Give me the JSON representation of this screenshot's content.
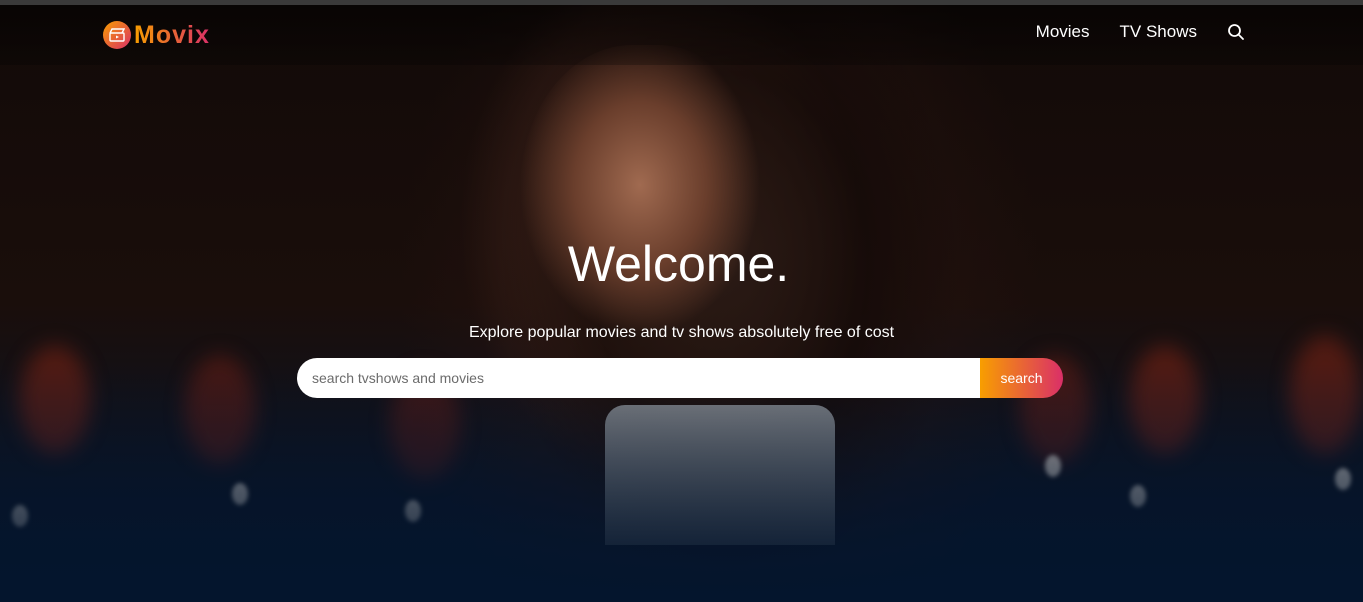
{
  "brand": {
    "name": "Movix",
    "accent_start": "#f89e00",
    "accent_end": "#da2f68",
    "icon": "clapperboard-icon"
  },
  "nav": {
    "items": [
      {
        "label": "Movies"
      },
      {
        "label": "TV Shows"
      }
    ],
    "search_icon": "search-icon"
  },
  "hero": {
    "title": "Welcome.",
    "subtitle": "Explore popular movies and tv shows absolutely free of cost",
    "search": {
      "placeholder": "search tvshows and movies",
      "value": "",
      "button_label": "search"
    },
    "background_color": "#04152d"
  }
}
